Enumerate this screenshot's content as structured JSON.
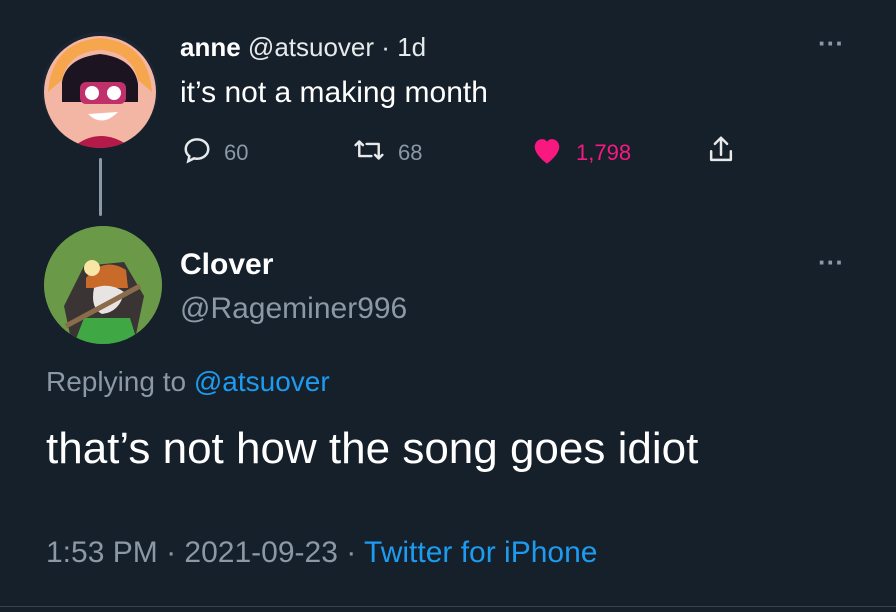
{
  "tweet": {
    "display_name": "anne",
    "handle": "@atsuover",
    "separator": "·",
    "time": "1d",
    "text": "it’s not a making month",
    "reply_count": "60",
    "retweet_count": "68",
    "like_count": "1,798",
    "more_label": "···",
    "colors": {
      "like": "#f91880",
      "muted": "#8b98a5",
      "background": "#15202b"
    }
  },
  "reply": {
    "display_name": "Clover",
    "handle": "@Rageminer996",
    "more_label": "···",
    "replying_prefix": "Replying to",
    "replying_to": "@atsuover",
    "text": "that’s not how the song goes idiot",
    "time": "1:53 PM",
    "separator": "·",
    "date": "2021-09-23",
    "source": "Twitter for iPhone",
    "colors": {
      "link": "#1d9bf0"
    }
  }
}
